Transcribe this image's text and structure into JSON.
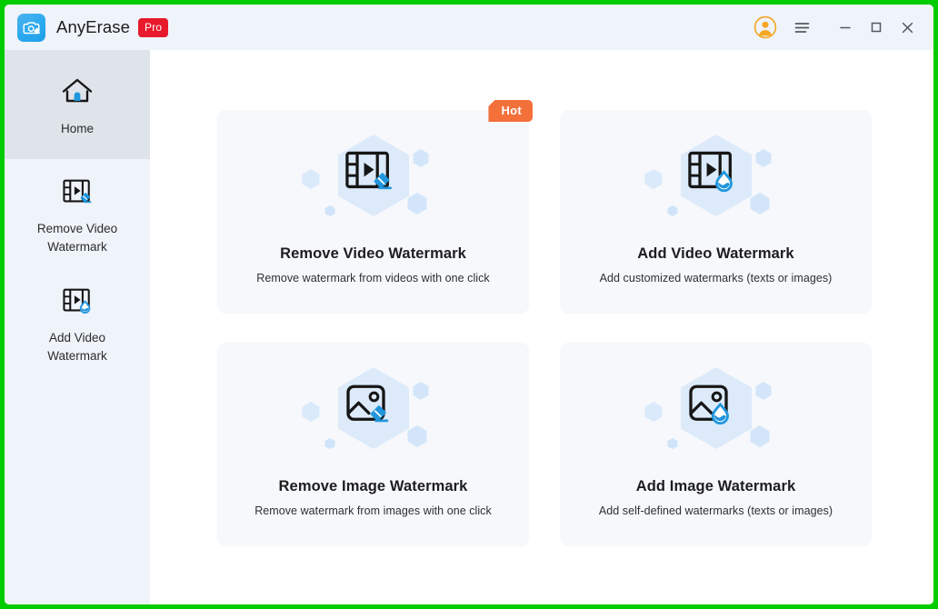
{
  "window": {
    "border_color": "#00cc00",
    "background": "#ffffff"
  },
  "titlebar": {
    "app_name": "AnyErase",
    "pro_badge": "Pro",
    "logo_icon": "camera-eraser-logo-icon",
    "background": "#eff3fa",
    "controls": [
      {
        "name": "account-avatar",
        "icon": "user-avatar-icon",
        "color": "#f5a623"
      },
      {
        "name": "menu",
        "icon": "hamburger-menu-icon"
      },
      {
        "name": "minimize",
        "icon": "minimize-icon"
      },
      {
        "name": "maximize",
        "icon": "maximize-icon"
      },
      {
        "name": "close",
        "icon": "close-icon"
      }
    ]
  },
  "sidebar": {
    "background": "#eff3fa",
    "active_background": "#dfe4ea",
    "items": [
      {
        "label": "Home",
        "icon": "home-icon",
        "active": true
      },
      {
        "label": "Remove Video\nWatermark",
        "line1": "Remove Video",
        "line2": "Watermark",
        "icon": "video-eraser-icon",
        "active": false
      },
      {
        "label": "Add Video\nWatermark",
        "line1": "Add Video",
        "line2": "Watermark",
        "icon": "video-droplet-icon",
        "active": false
      }
    ]
  },
  "main": {
    "background": "#ffffff",
    "cards": [
      {
        "id": "remove-video-watermark",
        "title": "Remove Video Watermark",
        "subtitle": "Remove watermark from videos with one click",
        "icon": "video-eraser-icon",
        "badge": "Hot",
        "badge_color": "#f3703a"
      },
      {
        "id": "add-video-watermark",
        "title": "Add Video Watermark",
        "subtitle": "Add customized watermarks (texts or images)",
        "icon": "video-droplet-icon",
        "badge": null
      },
      {
        "id": "remove-image-watermark",
        "title": "Remove Image Watermark",
        "subtitle": "Remove watermark from images with one click",
        "icon": "image-eraser-icon",
        "badge": null
      },
      {
        "id": "add-image-watermark",
        "title": "Add Image Watermark",
        "subtitle": "Add self-defined watermarks  (texts or images)",
        "icon": "image-droplet-icon",
        "badge": null
      }
    ]
  },
  "colors": {
    "accent_blue": "#2196dd",
    "card_background": "#f6f8fc",
    "hexagon_fill": "#dbeafb",
    "badge_red": "#e8192c",
    "badge_orange": "#f3703a",
    "border_green": "#00cc00"
  }
}
